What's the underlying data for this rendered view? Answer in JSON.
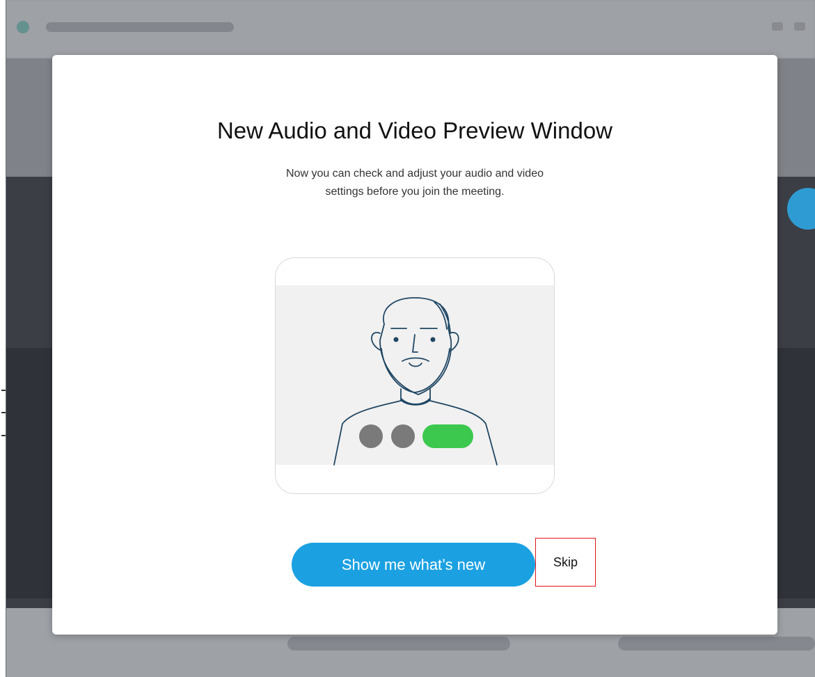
{
  "dialog": {
    "title": "New Audio and Video Preview Window",
    "description": "Now you can check and adjust your audio and video settings before you join the meeting.",
    "primary_button_label": "Show me what’s new",
    "skip_button_label": "Skip"
  },
  "colors": {
    "primary_button": "#1ba1e2",
    "highlight_border": "#e0141b",
    "toggle_on": "#3cc84f",
    "toggle_off": "#7a7a7a"
  },
  "illustration": {
    "subject": "bearded-person-avatar",
    "controls": [
      "mic-toggle-off",
      "camera-toggle-off",
      "video-toggle-on"
    ]
  }
}
